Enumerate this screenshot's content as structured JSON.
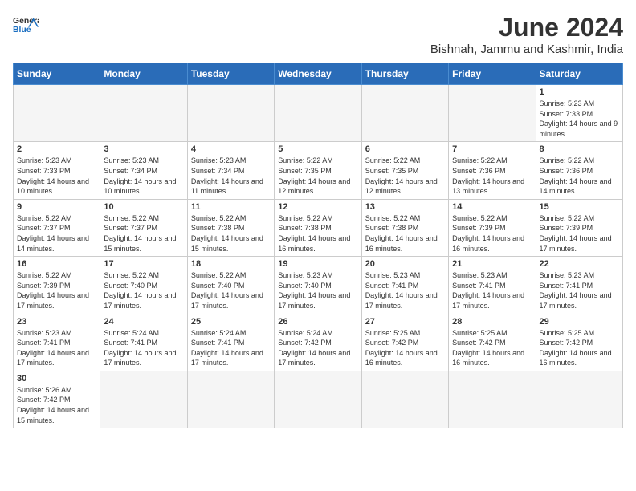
{
  "header": {
    "logo_general": "General",
    "logo_blue": "Blue",
    "month_year": "June 2024",
    "location": "Bishnah, Jammu and Kashmir, India"
  },
  "weekdays": [
    "Sunday",
    "Monday",
    "Tuesday",
    "Wednesday",
    "Thursday",
    "Friday",
    "Saturday"
  ],
  "days": [
    {
      "num": "",
      "sunrise": "",
      "sunset": "",
      "daylight": "",
      "empty": true
    },
    {
      "num": "",
      "sunrise": "",
      "sunset": "",
      "daylight": "",
      "empty": true
    },
    {
      "num": "",
      "sunrise": "",
      "sunset": "",
      "daylight": "",
      "empty": true
    },
    {
      "num": "",
      "sunrise": "",
      "sunset": "",
      "daylight": "",
      "empty": true
    },
    {
      "num": "",
      "sunrise": "",
      "sunset": "",
      "daylight": "",
      "empty": true
    },
    {
      "num": "",
      "sunrise": "",
      "sunset": "",
      "daylight": "",
      "empty": true
    },
    {
      "num": "1",
      "sunrise": "Sunrise: 5:23 AM",
      "sunset": "Sunset: 7:33 PM",
      "daylight": "Daylight: 14 hours and 9 minutes.",
      "empty": false
    },
    {
      "num": "2",
      "sunrise": "Sunrise: 5:23 AM",
      "sunset": "Sunset: 7:33 PM",
      "daylight": "Daylight: 14 hours and 10 minutes.",
      "empty": false
    },
    {
      "num": "3",
      "sunrise": "Sunrise: 5:23 AM",
      "sunset": "Sunset: 7:34 PM",
      "daylight": "Daylight: 14 hours and 10 minutes.",
      "empty": false
    },
    {
      "num": "4",
      "sunrise": "Sunrise: 5:23 AM",
      "sunset": "Sunset: 7:34 PM",
      "daylight": "Daylight: 14 hours and 11 minutes.",
      "empty": false
    },
    {
      "num": "5",
      "sunrise": "Sunrise: 5:22 AM",
      "sunset": "Sunset: 7:35 PM",
      "daylight": "Daylight: 14 hours and 12 minutes.",
      "empty": false
    },
    {
      "num": "6",
      "sunrise": "Sunrise: 5:22 AM",
      "sunset": "Sunset: 7:35 PM",
      "daylight": "Daylight: 14 hours and 12 minutes.",
      "empty": false
    },
    {
      "num": "7",
      "sunrise": "Sunrise: 5:22 AM",
      "sunset": "Sunset: 7:36 PM",
      "daylight": "Daylight: 14 hours and 13 minutes.",
      "empty": false
    },
    {
      "num": "8",
      "sunrise": "Sunrise: 5:22 AM",
      "sunset": "Sunset: 7:36 PM",
      "daylight": "Daylight: 14 hours and 14 minutes.",
      "empty": false
    },
    {
      "num": "9",
      "sunrise": "Sunrise: 5:22 AM",
      "sunset": "Sunset: 7:37 PM",
      "daylight": "Daylight: 14 hours and 14 minutes.",
      "empty": false
    },
    {
      "num": "10",
      "sunrise": "Sunrise: 5:22 AM",
      "sunset": "Sunset: 7:37 PM",
      "daylight": "Daylight: 14 hours and 15 minutes.",
      "empty": false
    },
    {
      "num": "11",
      "sunrise": "Sunrise: 5:22 AM",
      "sunset": "Sunset: 7:38 PM",
      "daylight": "Daylight: 14 hours and 15 minutes.",
      "empty": false
    },
    {
      "num": "12",
      "sunrise": "Sunrise: 5:22 AM",
      "sunset": "Sunset: 7:38 PM",
      "daylight": "Daylight: 14 hours and 16 minutes.",
      "empty": false
    },
    {
      "num": "13",
      "sunrise": "Sunrise: 5:22 AM",
      "sunset": "Sunset: 7:38 PM",
      "daylight": "Daylight: 14 hours and 16 minutes.",
      "empty": false
    },
    {
      "num": "14",
      "sunrise": "Sunrise: 5:22 AM",
      "sunset": "Sunset: 7:39 PM",
      "daylight": "Daylight: 14 hours and 16 minutes.",
      "empty": false
    },
    {
      "num": "15",
      "sunrise": "Sunrise: 5:22 AM",
      "sunset": "Sunset: 7:39 PM",
      "daylight": "Daylight: 14 hours and 17 minutes.",
      "empty": false
    },
    {
      "num": "16",
      "sunrise": "Sunrise: 5:22 AM",
      "sunset": "Sunset: 7:39 PM",
      "daylight": "Daylight: 14 hours and 17 minutes.",
      "empty": false
    },
    {
      "num": "17",
      "sunrise": "Sunrise: 5:22 AM",
      "sunset": "Sunset: 7:40 PM",
      "daylight": "Daylight: 14 hours and 17 minutes.",
      "empty": false
    },
    {
      "num": "18",
      "sunrise": "Sunrise: 5:22 AM",
      "sunset": "Sunset: 7:40 PM",
      "daylight": "Daylight: 14 hours and 17 minutes.",
      "empty": false
    },
    {
      "num": "19",
      "sunrise": "Sunrise: 5:23 AM",
      "sunset": "Sunset: 7:40 PM",
      "daylight": "Daylight: 14 hours and 17 minutes.",
      "empty": false
    },
    {
      "num": "20",
      "sunrise": "Sunrise: 5:23 AM",
      "sunset": "Sunset: 7:41 PM",
      "daylight": "Daylight: 14 hours and 17 minutes.",
      "empty": false
    },
    {
      "num": "21",
      "sunrise": "Sunrise: 5:23 AM",
      "sunset": "Sunset: 7:41 PM",
      "daylight": "Daylight: 14 hours and 17 minutes.",
      "empty": false
    },
    {
      "num": "22",
      "sunrise": "Sunrise: 5:23 AM",
      "sunset": "Sunset: 7:41 PM",
      "daylight": "Daylight: 14 hours and 17 minutes.",
      "empty": false
    },
    {
      "num": "23",
      "sunrise": "Sunrise: 5:23 AM",
      "sunset": "Sunset: 7:41 PM",
      "daylight": "Daylight: 14 hours and 17 minutes.",
      "empty": false
    },
    {
      "num": "24",
      "sunrise": "Sunrise: 5:24 AM",
      "sunset": "Sunset: 7:41 PM",
      "daylight": "Daylight: 14 hours and 17 minutes.",
      "empty": false
    },
    {
      "num": "25",
      "sunrise": "Sunrise: 5:24 AM",
      "sunset": "Sunset: 7:41 PM",
      "daylight": "Daylight: 14 hours and 17 minutes.",
      "empty": false
    },
    {
      "num": "26",
      "sunrise": "Sunrise: 5:24 AM",
      "sunset": "Sunset: 7:42 PM",
      "daylight": "Daylight: 14 hours and 17 minutes.",
      "empty": false
    },
    {
      "num": "27",
      "sunrise": "Sunrise: 5:25 AM",
      "sunset": "Sunset: 7:42 PM",
      "daylight": "Daylight: 14 hours and 16 minutes.",
      "empty": false
    },
    {
      "num": "28",
      "sunrise": "Sunrise: 5:25 AM",
      "sunset": "Sunset: 7:42 PM",
      "daylight": "Daylight: 14 hours and 16 minutes.",
      "empty": false
    },
    {
      "num": "29",
      "sunrise": "Sunrise: 5:25 AM",
      "sunset": "Sunset: 7:42 PM",
      "daylight": "Daylight: 14 hours and 16 minutes.",
      "empty": false
    },
    {
      "num": "30",
      "sunrise": "Sunrise: 5:26 AM",
      "sunset": "Sunset: 7:42 PM",
      "daylight": "Daylight: 14 hours and 15 minutes.",
      "empty": false
    },
    {
      "num": "",
      "sunrise": "",
      "sunset": "",
      "daylight": "",
      "empty": true
    },
    {
      "num": "",
      "sunrise": "",
      "sunset": "",
      "daylight": "",
      "empty": true
    },
    {
      "num": "",
      "sunrise": "",
      "sunset": "",
      "daylight": "",
      "empty": true
    },
    {
      "num": "",
      "sunrise": "",
      "sunset": "",
      "daylight": "",
      "empty": true
    },
    {
      "num": "",
      "sunrise": "",
      "sunset": "",
      "daylight": "",
      "empty": true
    },
    {
      "num": "",
      "sunrise": "",
      "sunset": "",
      "daylight": "",
      "empty": true
    }
  ]
}
